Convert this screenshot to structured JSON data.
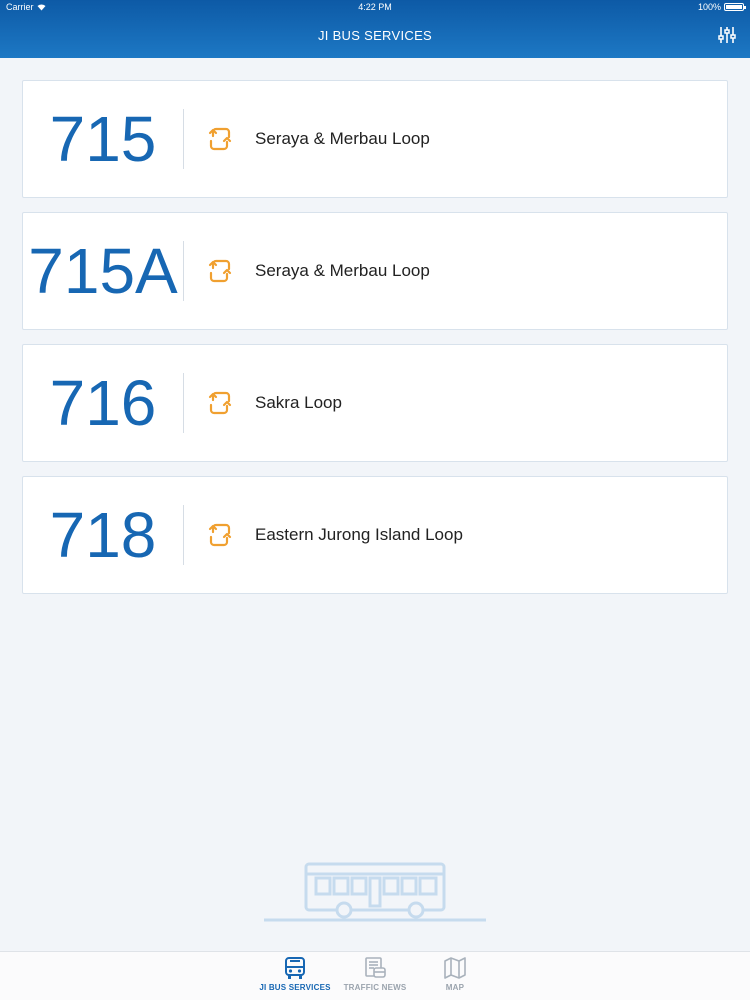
{
  "status_bar": {
    "carrier": "Carrier",
    "time": "4:22 PM",
    "battery": "100%"
  },
  "header": {
    "title": "JI BUS SERVICES",
    "filter_icon": "sliders-icon"
  },
  "routes": [
    {
      "number": "715",
      "name": "Seraya & Merbau Loop",
      "icon": "loop-icon"
    },
    {
      "number": "715A",
      "name": "Seraya & Merbau Loop",
      "icon": "loop-icon"
    },
    {
      "number": "716",
      "name": "Sakra Loop",
      "icon": "loop-icon"
    },
    {
      "number": "718",
      "name": "Eastern Jurong Island Loop",
      "icon": "loop-icon"
    }
  ],
  "tabs": [
    {
      "label": "JI BUS SERVICES",
      "icon": "bus-icon",
      "active": true
    },
    {
      "label": "TRAFFIC NEWS",
      "icon": "traffic-news-icon",
      "active": false
    },
    {
      "label": "MAP",
      "icon": "map-icon",
      "active": false
    }
  ],
  "colors": {
    "header": "#1767b3",
    "route_number": "#1767b3",
    "loop_icon": "#f0a030",
    "background": "#f2f5f9"
  }
}
